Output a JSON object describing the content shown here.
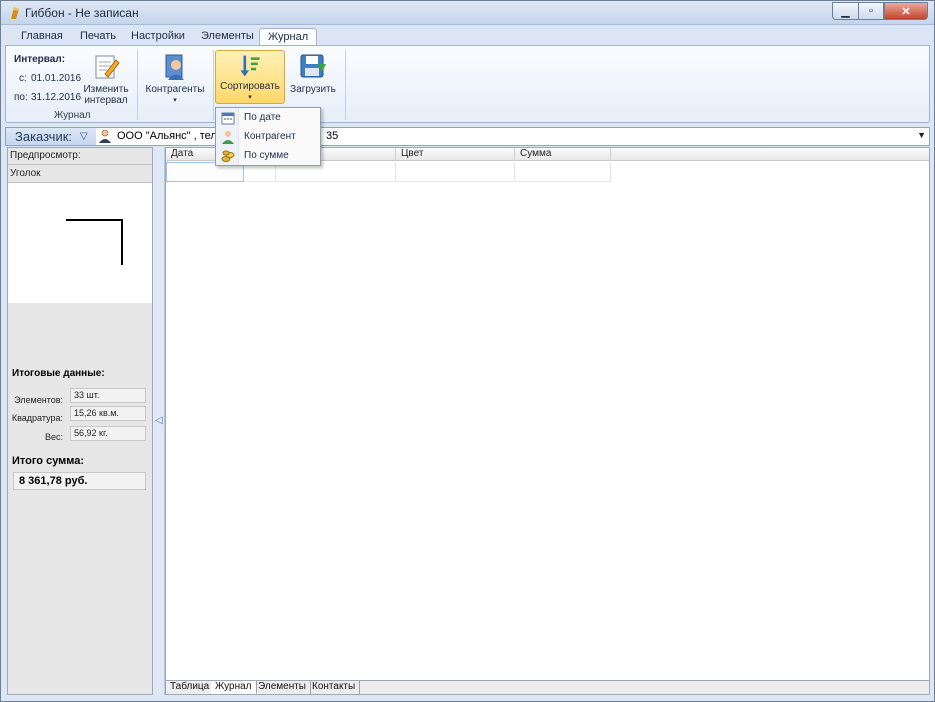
{
  "window": {
    "title": "Гиббон - Не записан"
  },
  "ribbon_tabs": [
    "Главная",
    "Печать",
    "Настройки",
    "Элементы",
    "Журнал"
  ],
  "interval": {
    "label": "Интервал:",
    "from_prefix": "с:",
    "from": "01.01.2016",
    "to_prefix": "по:",
    "to": "31.12.2016"
  },
  "ribbon": {
    "change_interval": "Изменить интервал",
    "group_journal": "Журнал",
    "counterparties": "Контрагенты",
    "sort": "Сортировать",
    "load": "Загрузить"
  },
  "sort_menu": [
    {
      "label": "По дате",
      "icon": "calendar-icon"
    },
    {
      "label": "Контрагент",
      "icon": "person-icon"
    },
    {
      "label": "По сумме",
      "icon": "coins-icon"
    }
  ],
  "customer": {
    "label": "Заказчик:",
    "value": "ООО \"Альянс\" , тел.:5209",
    "value_tail": "35"
  },
  "left_panel": {
    "preview_label": "Предпросмотр:",
    "item_name": "Уголок",
    "summary_title": "Итоговые данные:",
    "elements_key": "Элементов:",
    "elements_val": "33 шт.",
    "area_key": "Квадратура:",
    "area_val": "15,26 кв.м.",
    "weight_key": "Вес:",
    "weight_val": "56,92 кг.",
    "total_title": "Итого сумма:",
    "total_val": "8 361,78 руб."
  },
  "grid": {
    "columns": [
      "Дата",
      "",
      "Цвет",
      "Сумма"
    ]
  },
  "bottom_tabs": [
    "Таблица",
    "Журнал",
    "Элементы",
    "Контакты"
  ],
  "colors": {
    "accent": "#ffd86a",
    "ribbon_bg": "#e6eef9",
    "title_bg": "#c4d5ec",
    "close": "#c7432d"
  }
}
